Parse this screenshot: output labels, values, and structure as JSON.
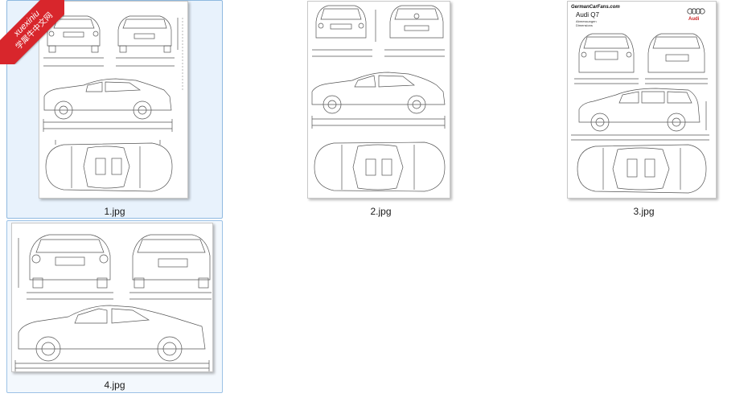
{
  "watermark": {
    "line1": "xuexiniu",
    "line2": "学犀牛中文网",
    "color": "#d8262c"
  },
  "files": [
    {
      "name": "1.jpg",
      "selected": true,
      "icon": "car-blueprint-thumbnail"
    },
    {
      "name": "2.jpg",
      "selected": false,
      "icon": "car-blueprint-thumbnail"
    },
    {
      "name": "3.jpg",
      "selected": false,
      "icon": "car-blueprint-thumbnail"
    },
    {
      "name": "4.jpg",
      "selected": false,
      "hover": true,
      "icon": "car-blueprint-thumbnail"
    }
  ],
  "thumb3": {
    "site": "GermanCarFans.com",
    "title": "Audi Q7",
    "sub1": "Abmessungen",
    "sub2": "Dimensions",
    "brand": "Audi"
  }
}
